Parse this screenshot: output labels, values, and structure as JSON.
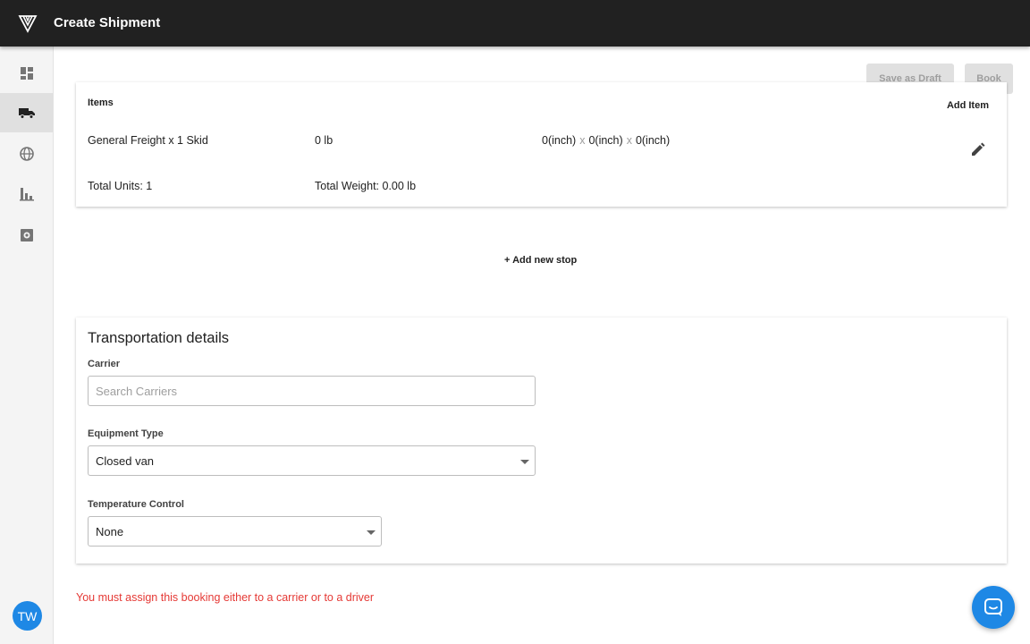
{
  "header": {
    "title": "Create Shipment",
    "logo_icon": "logo-icon"
  },
  "sidebar": {
    "items": [
      {
        "icon": "dashboard-icon",
        "active": false
      },
      {
        "icon": "truck-icon",
        "active": true
      },
      {
        "icon": "globe-icon",
        "active": false
      },
      {
        "icon": "bar-chart-icon",
        "active": false
      },
      {
        "icon": "settings-icon",
        "active": false
      }
    ],
    "avatar_initials": "TW"
  },
  "toolbar": {
    "save_draft_label": "Save as Draft",
    "book_label": "Book"
  },
  "items_card": {
    "section_label": "Items",
    "add_item_label": "Add Item",
    "item": {
      "description": "General Freight x 1 Skid",
      "weight": "0 lb",
      "length": "0(inch)",
      "width": "0(inch)",
      "height": "0(inch)",
      "separator": "x"
    },
    "total_units": "Total Units: 1",
    "total_weight": "Total Weight: 0.00 lb"
  },
  "add_stop_label": "+ Add new stop",
  "transportation": {
    "title": "Transportation details",
    "carrier_label": "Carrier",
    "carrier_placeholder": "Search Carriers",
    "equipment_label": "Equipment Type",
    "equipment_value": "Closed van",
    "temperature_label": "Temperature Control",
    "temperature_value": "None"
  },
  "error_message": "You must assign this booking either to a carrier or to a driver",
  "colors": {
    "accent": "#1e88e5",
    "error": "#e53935",
    "topbar": "#212121"
  }
}
